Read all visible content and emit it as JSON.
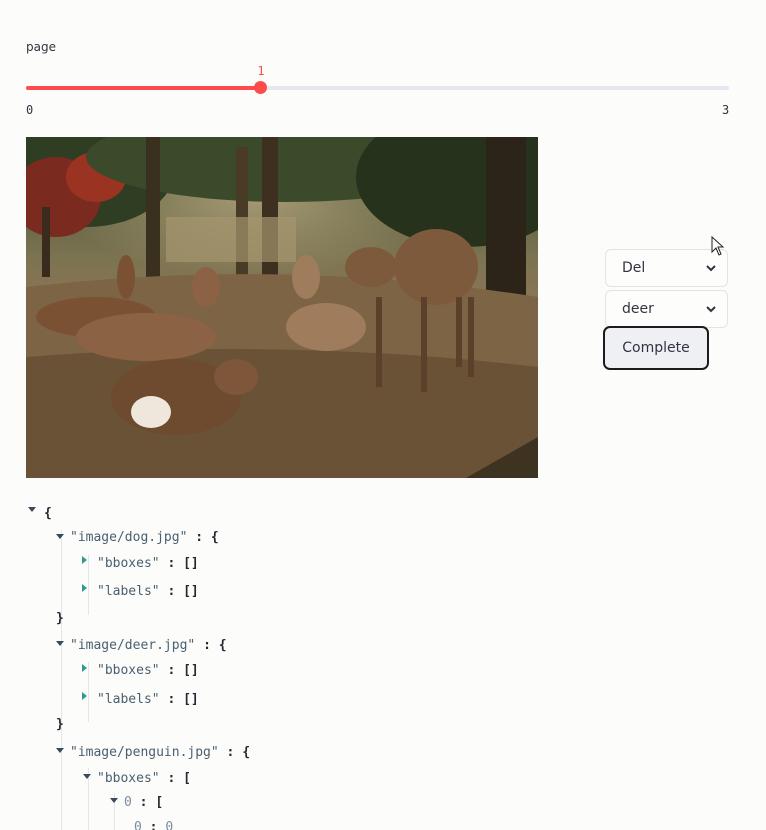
{
  "slider": {
    "label": "page",
    "value": "1",
    "min": "0",
    "max": "3",
    "fraction": 0.333,
    "accent_color": "#ff4b4b"
  },
  "image": {
    "subject": "deer resting and standing on dirt ground among trees"
  },
  "controls": {
    "action_select": {
      "value": "Del"
    },
    "label_select": {
      "value": "deer"
    },
    "complete_button": "Complete"
  },
  "json_tree": {
    "open_brace": "{",
    "entries": [
      {
        "key": "\"image/dog.jpg\"",
        "bboxes_key": "\"bboxes\"",
        "bboxes_val": "[]",
        "labels_key": "\"labels\"",
        "labels_val": "[]"
      },
      {
        "key": "\"image/deer.jpg\"",
        "bboxes_key": "\"bboxes\"",
        "bboxes_val": "[]",
        "labels_key": "\"labels\"",
        "labels_val": "[]"
      },
      {
        "key": "\"image/penguin.jpg\"",
        "bboxes_key": "\"bboxes\"",
        "item_index": "0",
        "item_inner_key": "0",
        "item_inner_val": "0"
      }
    ],
    "colon": ":",
    "brace_open": "{",
    "brace_close": "}",
    "bracket_open": "["
  }
}
